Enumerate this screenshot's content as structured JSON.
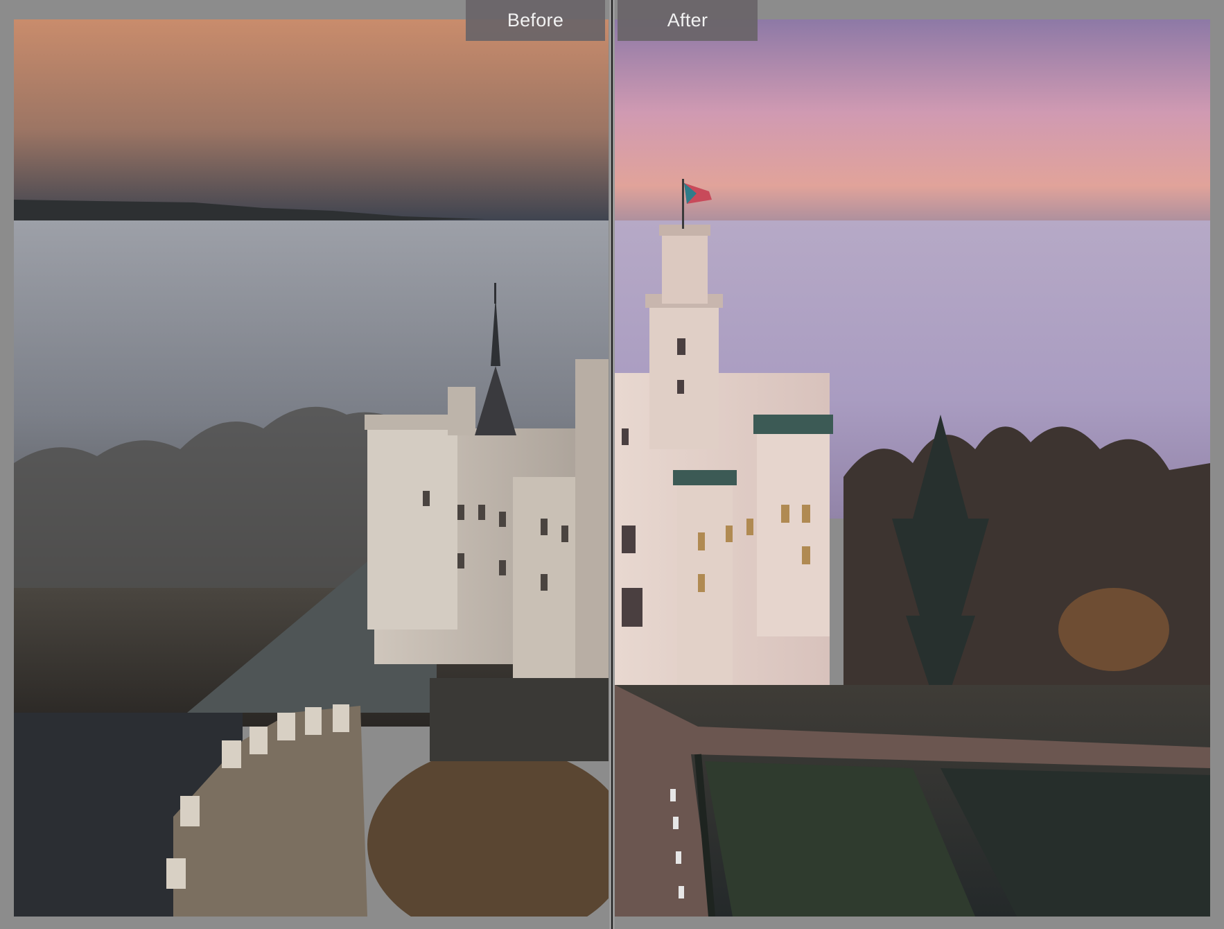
{
  "comparison": {
    "before_label": "Before",
    "after_label": "After"
  },
  "colors": {
    "frame": "#8c8c8c",
    "divider": "#1a1a1a",
    "tab_bg": "#69646a",
    "tab_text": "#f2f2f2"
  }
}
